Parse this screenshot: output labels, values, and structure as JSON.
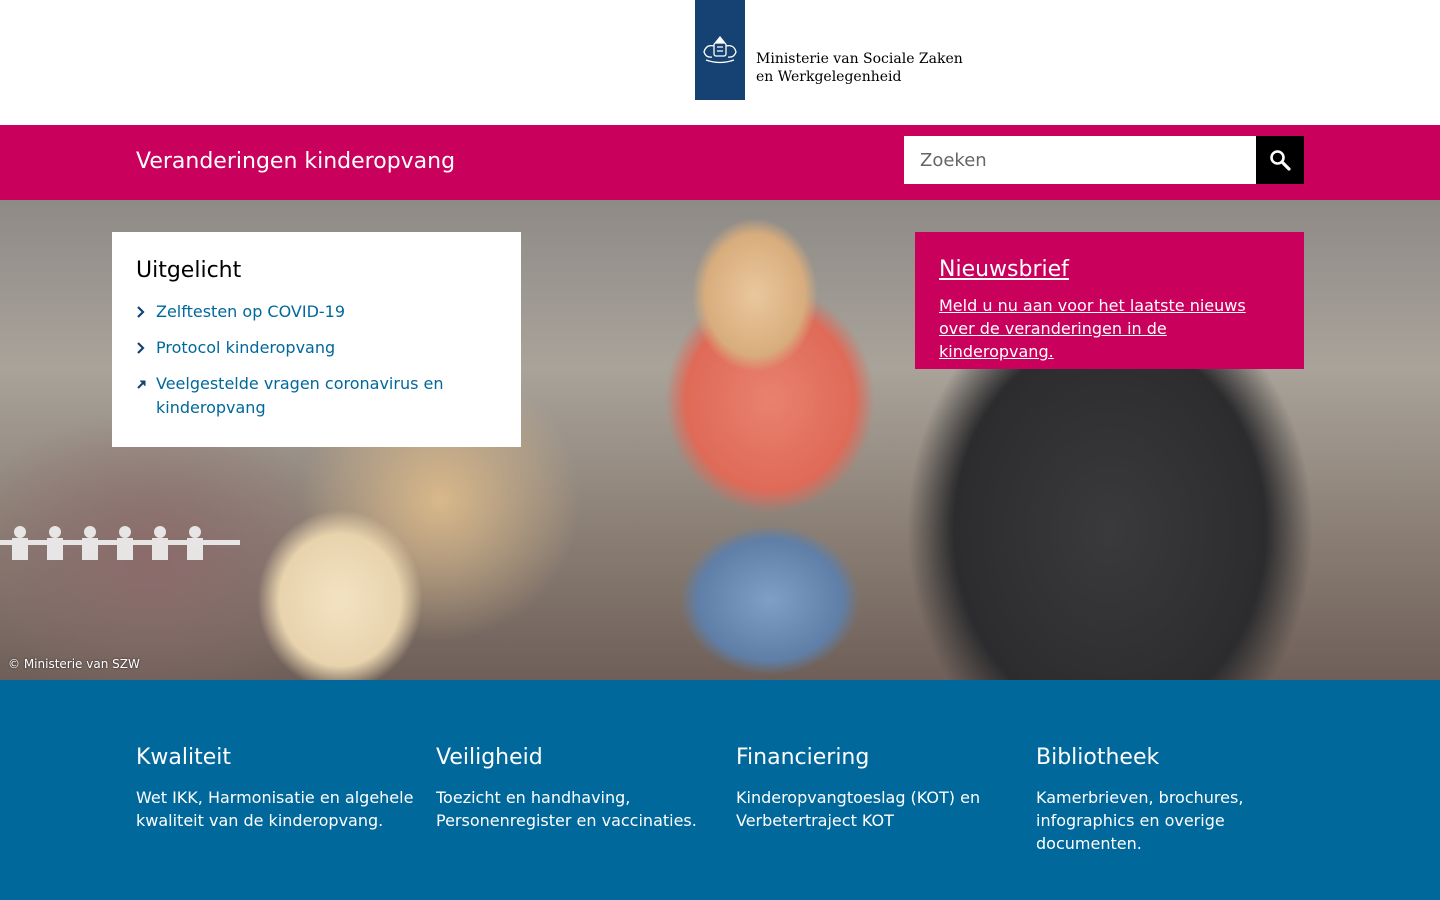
{
  "header": {
    "ministry_name": "Ministerie van Sociale Zaken en Werkgelegenheid"
  },
  "topbar": {
    "site_title": "Veranderingen kinderopvang",
    "search": {
      "placeholder": "Zoeken",
      "value": ""
    }
  },
  "hero": {
    "photo_credit": "© Ministerie van SZW",
    "featured": {
      "title": "Uitgelicht",
      "items": [
        {
          "label": "Zelftesten op COVID-19",
          "icon": "chevron-right-icon"
        },
        {
          "label": "Protocol kinderopvang",
          "icon": "chevron-right-icon"
        },
        {
          "label": "Veelgestelde vragen coronavirus en kinderopvang",
          "icon": "external-link-icon"
        }
      ]
    },
    "newsletter": {
      "title": "Nieuwsbrief",
      "text": "Meld u nu aan voor het laatste nieuws over de veranderingen in de kinderopvang."
    }
  },
  "topics": [
    {
      "title": "Kwaliteit",
      "description": "Wet IKK, Harmonisatie en algehele kwaliteit van de kinderopvang."
    },
    {
      "title": "Veiligheid",
      "description": "Toezicht en handhaving, Personenregister en vaccinaties."
    },
    {
      "title": "Financiering",
      "description": "Kinderopvangtoeslag (KOT) en Verbetertraject KOT"
    },
    {
      "title": "Bibliotheek",
      "description": "Kamerbrieven, brochures, infographics en overige documenten."
    }
  ],
  "colors": {
    "brand_pink": "#ca005d",
    "brand_blue": "#01689b",
    "logo_blue": "#154273"
  }
}
